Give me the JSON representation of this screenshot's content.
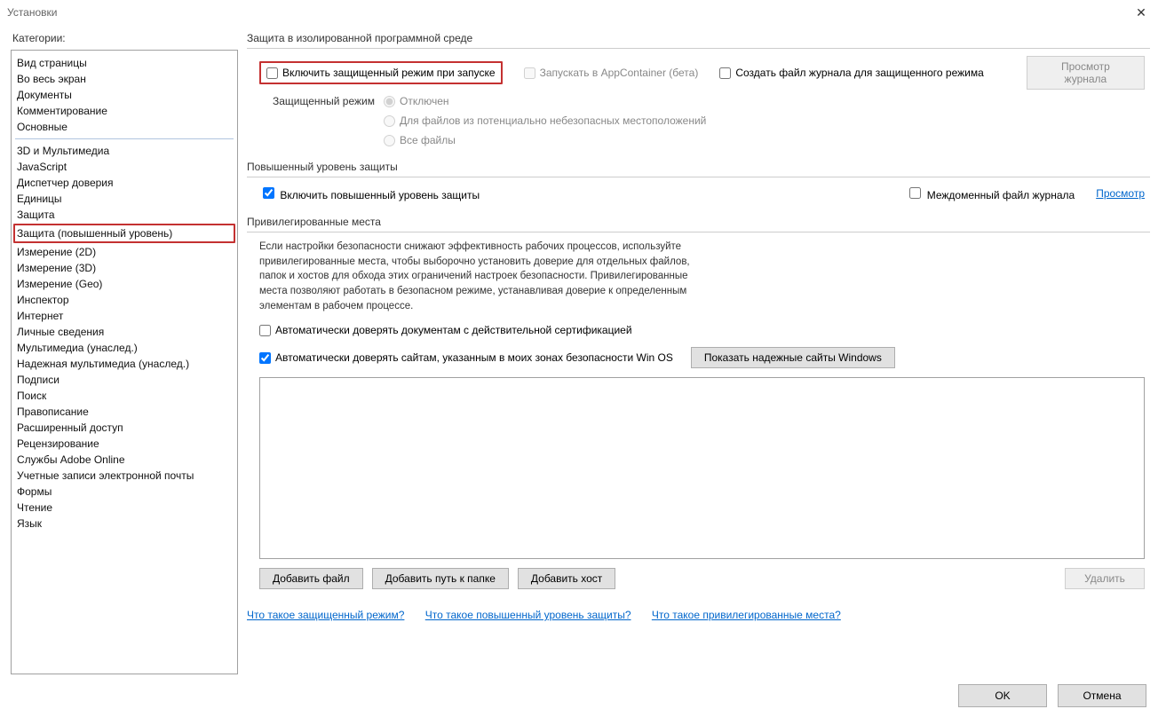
{
  "window": {
    "title": "Установки"
  },
  "sidebar": {
    "label": "Категории:",
    "group1": [
      "Вид страницы",
      "Во весь экран",
      "Документы",
      "Комментирование",
      "Основные"
    ],
    "group2": [
      "3D и Мультимедиа",
      "JavaScript",
      "Диспетчер доверия",
      "Единицы",
      "Защита",
      "Защита (повышенный уровень)",
      "Измерение (2D)",
      "Измерение (3D)",
      "Измерение (Geo)",
      "Инспектор",
      "Интернет",
      "Личные сведения",
      "Мультимедиа (унаслед.)",
      "Надежная мультимедиа (унаслед.)",
      "Подписи",
      "Поиск",
      "Правописание",
      "Расширенный доступ",
      "Рецензирование",
      "Службы Adobe Online",
      "Учетные записи электронной почты",
      "Формы",
      "Чтение",
      "Язык"
    ],
    "selectedIndex": 5
  },
  "sandbox": {
    "heading": "Защита в изолированной программной среде",
    "enable_protected": "Включить защищенный режим при запуске",
    "appcontainer": "Запускать в AppContainer (бета)",
    "create_log": "Создать файл журнала для защищенного режима",
    "view_log_btn": "Просмотр журнала",
    "mode_label": "Защищенный режим",
    "mode_off": "Отключен",
    "mode_unsafe": "Для файлов из потенциально небезопасных местоположений",
    "mode_all": "Все файлы"
  },
  "enhanced": {
    "heading": "Повышенный уровень защиты",
    "enable": "Включить повышенный уровень защиты",
    "crossdomain": "Междоменный файл журнала",
    "view": "Просмотр"
  },
  "privileged": {
    "heading": "Привилегированные места",
    "info": "Если настройки безопасности снижают эффективность рабочих процессов, используйте привилегированные места, чтобы выборочно установить доверие для отдельных файлов, папок и хостов для обхода этих ограничений настроек безопасности. Привилегированные места позволяют работать в безопасном режиме, устанавливая доверие к определенным элементам в рабочем процессе.",
    "trust_cert": "Автоматически доверять документам с действительной сертификацией",
    "trust_zones": "Автоматически доверять сайтам, указанным в моих зонах безопасности Win OS",
    "show_trusted_btn": "Показать надежные сайты Windows",
    "add_file": "Добавить файл",
    "add_folder": "Добавить путь к папке",
    "add_host": "Добавить хост",
    "remove": "Удалить"
  },
  "links": {
    "l1": "Что такое защищенный режим?",
    "l2": "Что такое повышенный уровень защиты?",
    "l3": "Что такое привилегированные места?"
  },
  "footer": {
    "ok": "OK",
    "cancel": "Отмена"
  }
}
